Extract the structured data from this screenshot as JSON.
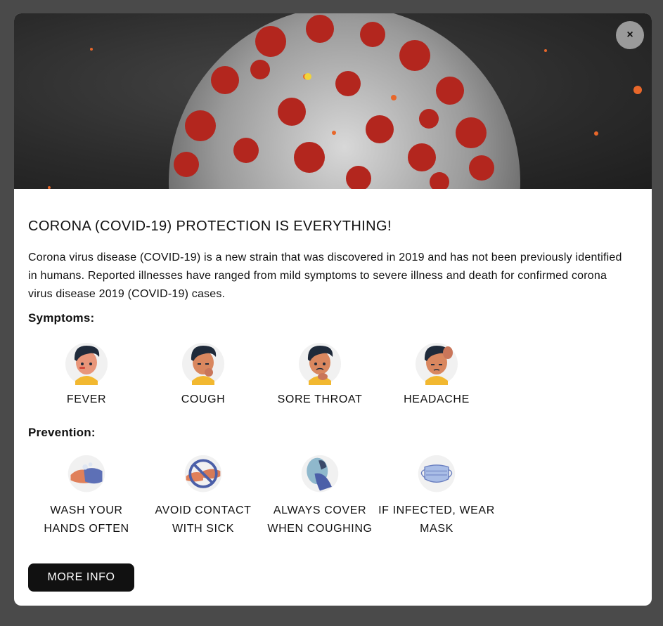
{
  "modal": {
    "close_label": "×",
    "title": "CORONA (COVID-19) PROTECTION IS EVERYTHING!",
    "description": "Corona virus disease (COVID-19) is a new strain that was discovered in 2019 and has not been previously identified in humans. Reported illnesses have ranged from mild symptoms to severe illness and death for confirmed corona virus disease 2019 (COVID-19) cases.",
    "symptoms_heading": "Symptoms:",
    "symptoms": [
      {
        "label": "FEVER",
        "icon": "fever-icon"
      },
      {
        "label": "COUGH",
        "icon": "cough-icon"
      },
      {
        "label": "SORE THROAT",
        "icon": "sore-throat-icon"
      },
      {
        "label": "HEADACHE",
        "icon": "headache-icon"
      }
    ],
    "prevention_heading": "Prevention:",
    "prevention": [
      {
        "label": "WASH YOUR HANDS OFTEN",
        "icon": "wash-hands-icon"
      },
      {
        "label": "AVOID CONTACT WITH SICK",
        "icon": "avoid-contact-icon"
      },
      {
        "label": "ALWAYS COVER WHEN COUGHING",
        "icon": "cover-cough-icon"
      },
      {
        "label": "IF INFECTED, WEAR MASK",
        "icon": "mask-icon"
      }
    ],
    "more_info_label": "MORE INFO"
  },
  "colors": {
    "backdrop": "#4a4a4a",
    "button": "#111111",
    "virus_red": "#b3261e",
    "sweater": "#f2b830"
  }
}
